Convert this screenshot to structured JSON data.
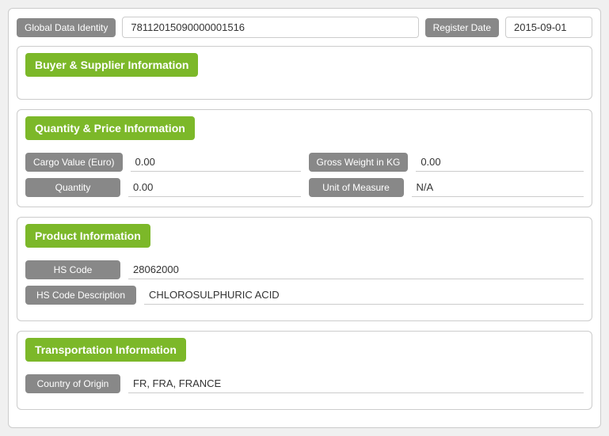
{
  "globalData": {
    "gdiLabel": "Global Data Identity",
    "gdiValue": "78112015090000001516",
    "registerLabel": "Register Date",
    "registerValue": "2015-09-01"
  },
  "sections": {
    "buyerSupplier": {
      "title": "Buyer & Supplier Information",
      "fields": []
    },
    "quantityPrice": {
      "title": "Quantity & Price Information",
      "row1": {
        "col1Label": "Cargo Value (Euro)",
        "col1Value": "0.00",
        "col2Label": "Gross Weight in KG",
        "col2Value": "0.00"
      },
      "row2": {
        "col1Label": "Quantity",
        "col1Value": "0.00",
        "col2Label": "Unit of Measure",
        "col2Value": "N/A"
      }
    },
    "product": {
      "title": "Product Information",
      "row1Label": "HS Code",
      "row1Value": "28062000",
      "row2Label": "HS Code Description",
      "row2Value": "CHLOROSULPHURIC ACID"
    },
    "transportation": {
      "title": "Transportation Information",
      "row1Label": "Country of Origin",
      "row1Value": "FR, FRA, FRANCE"
    }
  }
}
